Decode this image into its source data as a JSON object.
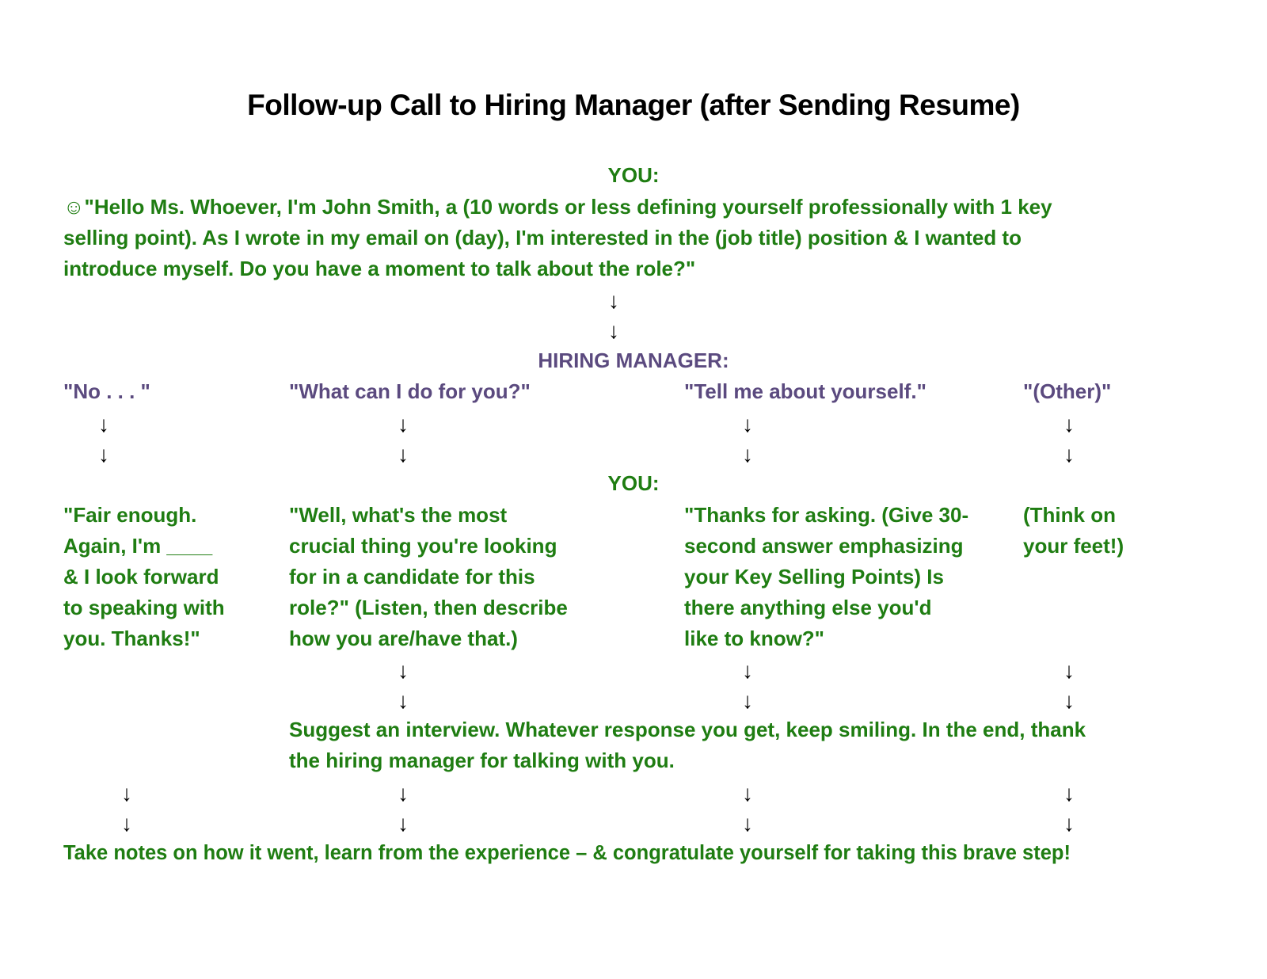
{
  "title": "Follow-up Call to Hiring Manager (after Sending Resume)",
  "you_label": "YOU:",
  "intro": {
    "icon": "☺",
    "line1": "\"Hello Ms. Whoever, I'm John Smith, a (10 words or less defining yourself professionally with 1 key",
    "line2": "selling point). As I wrote in my email on (day), I'm interested in the (job title) position & I wanted to",
    "line3": "introduce myself. Do you have a moment to talk about the role?\""
  },
  "arrow": "↓",
  "hiring_manager_label": "HIRING MANAGER:",
  "manager_responses": [
    "\"No . . . \"",
    "\"What can I do for you?\"",
    "\"Tell me about yourself.\"",
    "\"(Other)\""
  ],
  "you_responses": [
    [
      "\"Fair enough.",
      "Again, I'm ____",
      "& I look forward",
      "to speaking with",
      "you. Thanks!\""
    ],
    [
      "\"Well, what's the most",
      "crucial thing you're looking",
      "for in a candidate for this",
      "role?\" (Listen, then describe",
      "how you are/have that.)"
    ],
    [
      "\"Thanks for asking. (Give 30-",
      "second answer emphasizing",
      "your Key Selling Points) Is",
      "there anything else you'd",
      "like to know?\""
    ],
    [
      "(Think on",
      "your feet!)"
    ]
  ],
  "suggest": {
    "line1": "Suggest an interview. Whatever response you get, keep smiling. In the end, thank",
    "line2": "the hiring manager for talking with you."
  },
  "final": "Take notes on how it went, learn from the experience – & congratulate yourself for taking this brave step!",
  "colors": {
    "you_text": "#1f7d12",
    "manager_text": "#5b4a7f",
    "title_text": "#000000"
  }
}
